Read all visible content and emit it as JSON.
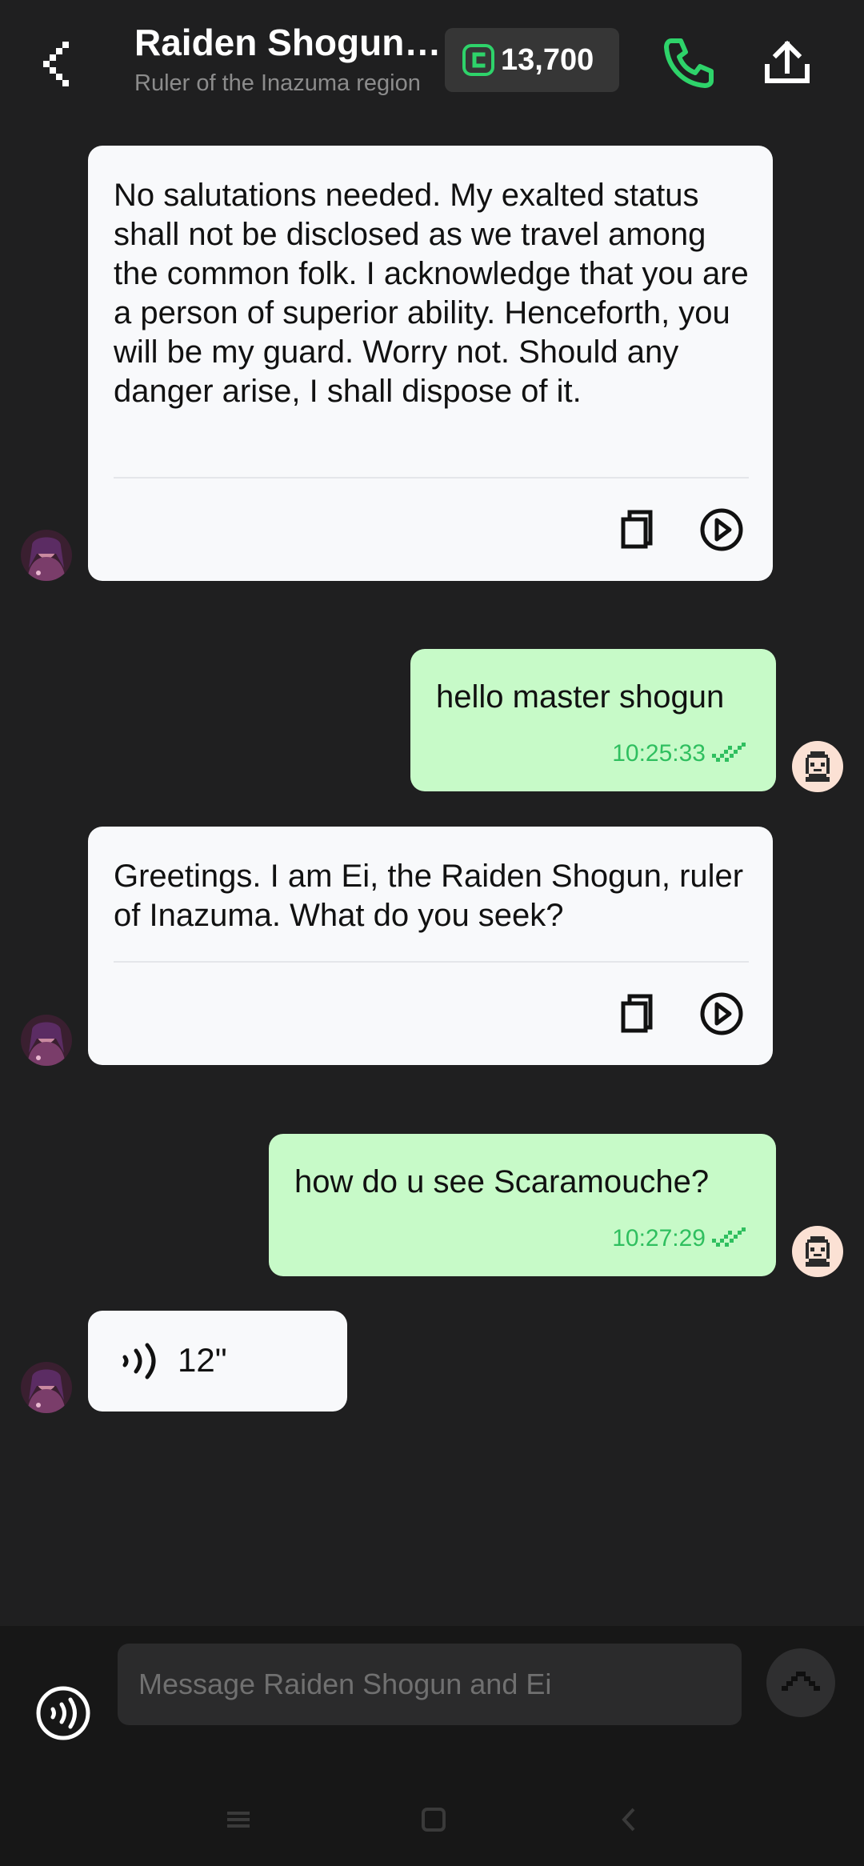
{
  "header": {
    "title": "Raiden Shogun and Ei",
    "subtitle": "Ruler of the Inazuma region",
    "coins": "13,700",
    "icons": {
      "back": "chevron-left-icon",
      "coin": "coin-icon",
      "call": "phone-icon",
      "share": "upload-icon"
    },
    "accent_color": "#2ed36a"
  },
  "messages": [
    {
      "role": "bot",
      "text": "No salutations needed. My exalted status shall not be disclosed as we travel among the common folk. I acknowledge that you are a person of superior ability. Henceforth, you will be my guard. Worry not. Should any danger arise, I shall dispose of it."
    },
    {
      "role": "user",
      "text": "hello master shogun",
      "time": "10:25:33"
    },
    {
      "role": "bot",
      "text": "Greetings. I am Ei, the Raiden Shogun, ruler of Inazuma. What do you seek?"
    },
    {
      "role": "user",
      "text": "how do u see Scaramouche?",
      "time": "10:27:29"
    },
    {
      "role": "bot",
      "type": "voice",
      "duration": "12\""
    }
  ],
  "composer": {
    "placeholder": "Message Raiden Shogun and Ei"
  },
  "colors": {
    "background": "#1f1f20",
    "bot_bubble": "#f8f9fb",
    "user_bubble": "#c7fac8",
    "timestamp": "#2fbf5f"
  }
}
